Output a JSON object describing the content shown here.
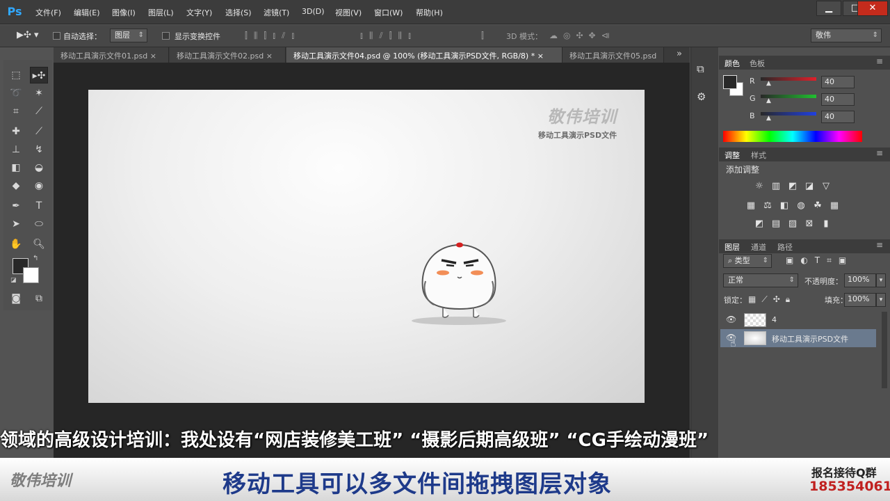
{
  "menu": {
    "logo": "Ps",
    "items": [
      "文件(F)",
      "编辑(E)",
      "图像(I)",
      "图层(L)",
      "文字(Y)",
      "选择(S)",
      "滤镜(T)",
      "3D(D)",
      "视图(V)",
      "窗口(W)",
      "帮助(H)"
    ],
    "win_min": "▁",
    "win_max": "□",
    "win_close": "✕"
  },
  "options": {
    "auto_select_label": "自动选择：",
    "auto_select_target": "图层",
    "show_transform_label": "显示变换控件",
    "mode_3d_label": "3D 模式：",
    "workspace": "敬伟"
  },
  "tabs": [
    {
      "label": "移动工具演示文件01.psd",
      "close": "×"
    },
    {
      "label": "移动工具演示文件02.psd",
      "close": "×"
    },
    {
      "label": "移动工具演示文件04.psd @ 100% (移动工具演示PSD文件, RGB/8) *",
      "close": "×"
    },
    {
      "label": "移动工具演示文件05.psd",
      "close": ""
    }
  ],
  "tabs_more": "»",
  "canvas": {
    "watermark_logo": "敬伟培训",
    "watermark_sub": "移动工具演示PSD文件"
  },
  "color_panel": {
    "tabs": [
      "颜色",
      "色板"
    ],
    "channels": [
      {
        "label": "R",
        "value": "40",
        "color": "#e0202a"
      },
      {
        "label": "G",
        "value": "40",
        "color": "#20c030"
      },
      {
        "label": "B",
        "value": "40",
        "color": "#2040e0"
      }
    ]
  },
  "adjust_panel": {
    "tabs": [
      "调整",
      "样式"
    ],
    "title": "添加调整"
  },
  "layers_panel": {
    "tabs": [
      "图层",
      "通道",
      "路径"
    ],
    "filter_kind": "类型",
    "blend_mode": "正常",
    "opacity_label": "不透明度：",
    "opacity": "100%",
    "lock_label": "锁定：",
    "fill_label": "填充：",
    "fill": "100%",
    "layers": [
      {
        "name": "4",
        "selected": false
      },
      {
        "name": "移动工具演示PSD文件",
        "selected": true
      }
    ]
  },
  "caption": {
    "scroll_text": "领域的高级设计培训：我处设有“网店装修美工班” “摄影后期高级班” “CG手绘动漫班”",
    "logo": "敬伟培训",
    "main": "移动工具可以多文件间拖拽图层对象",
    "qq_label": "报名接待Q群",
    "phone": "185354061"
  }
}
